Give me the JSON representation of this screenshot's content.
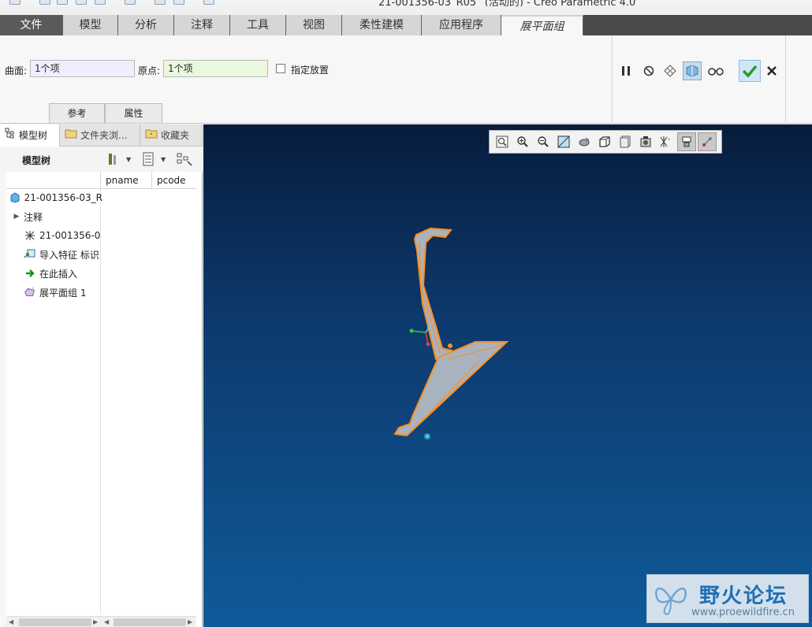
{
  "window": {
    "title": "21-001356-03_R05_ (活动的) - Creo Parametric 4.0"
  },
  "ribbon": {
    "tabs": [
      {
        "label": "文件"
      },
      {
        "label": "模型"
      },
      {
        "label": "分析"
      },
      {
        "label": "注释"
      },
      {
        "label": "工具"
      },
      {
        "label": "视图"
      },
      {
        "label": "柔性建模"
      },
      {
        "label": "应用程序"
      },
      {
        "label": "展平面组"
      }
    ]
  },
  "dashboard": {
    "surface_label": "曲面:",
    "surface_value": "1个项",
    "origin_label": "原点:",
    "origin_value": "1个项",
    "placement_label": "指定放置",
    "placement_checked": false,
    "slideup_tabs": [
      "参考",
      "属性"
    ]
  },
  "navigator": {
    "tabs": [
      {
        "label": "模型树"
      },
      {
        "label": "文件夹浏..."
      },
      {
        "label": "收藏夹"
      }
    ],
    "tree_label": "模型树",
    "columns": [
      "pname",
      "pcode"
    ],
    "nodes": [
      {
        "label": "21-001356-03_R",
        "icon": "part-icon"
      },
      {
        "label": "注释",
        "icon": "expand-arrow-icon"
      },
      {
        "label": "21-001356-0",
        "icon": "coordinate-system-icon"
      },
      {
        "label": "导入特征 标识",
        "icon": "import-feature-icon"
      },
      {
        "label": "在此插入",
        "icon": "insert-here-arrow-icon"
      },
      {
        "label": "展平面组 1",
        "icon": "flatten-quilt-icon"
      }
    ]
  },
  "watermark": {
    "name": "野火论坛",
    "url": "www.proewildfire.cn"
  },
  "colors": {
    "model_edge": "#ff8c1a",
    "model_fill": "#a9b3bf",
    "confirm": "#2a9a2a"
  }
}
